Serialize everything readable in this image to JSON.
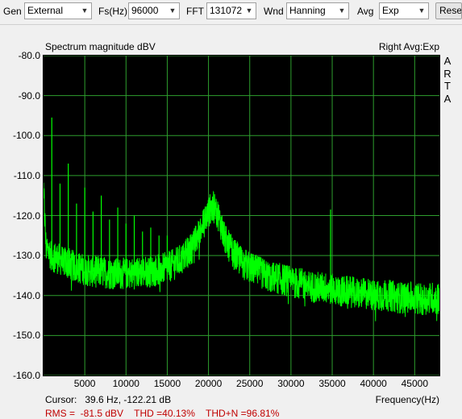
{
  "toolbar": {
    "gen_label": "Gen",
    "gen_value": "External",
    "fs_label": "Fs(Hz)",
    "fs_value": "96000",
    "fft_label": "FFT",
    "fft_value": "131072",
    "wnd_label": "Wnd",
    "wnd_value": "Hanning",
    "avg_label": "Avg",
    "avg_value": "Exp",
    "reset_label": "Reset"
  },
  "plot": {
    "title": "Spectrum magnitude dBV",
    "mode": "Right Avg:Exp",
    "watermark": [
      "A",
      "R",
      "T",
      "A"
    ],
    "cursor_readout": "Cursor:   39.6 Hz, -122.21 dB",
    "stats": "RMS =  -81.5 dBV    THD =40.13%    THD+N =96.81%"
  },
  "chart_data": {
    "type": "line",
    "title": "Spectrum magnitude dBV",
    "xlabel": "Frequency(Hz)",
    "ylabel": "",
    "xlim": [
      0,
      48000
    ],
    "ylim": [
      -160,
      -80
    ],
    "xticks": [
      5000,
      10000,
      15000,
      20000,
      25000,
      30000,
      35000,
      40000,
      45000
    ],
    "xtick_labels": [
      "5000",
      "10000",
      "15000",
      "20000",
      "25000",
      "30000",
      "35000",
      "40000",
      "45000"
    ],
    "yticks": [
      -80,
      -90,
      -100,
      -110,
      -120,
      -130,
      -140,
      -150,
      -160
    ],
    "ytick_labels": [
      "-80.0",
      "-90.0",
      "-100.0",
      "-110.0",
      "-120.0",
      "-130.0",
      "-140.0",
      "-150.0",
      "-160.0"
    ],
    "grid": true,
    "series": [
      {
        "color": "#00ff00",
        "x": [
          0,
          300,
          1000,
          2000,
          3000,
          4000,
          5000,
          6000,
          7000,
          8000,
          9000,
          10000,
          11000,
          12000,
          13000,
          14000,
          15000,
          16000,
          17000,
          18000,
          19000,
          19800,
          20300,
          20700,
          21200,
          22000,
          23000,
          24000,
          25000,
          26000,
          27000,
          28000,
          29000,
          30000,
          31000,
          32000,
          33000,
          34000,
          35000,
          36000,
          37000,
          38000,
          39000,
          40000,
          41000,
          42000,
          43000,
          44000,
          45000,
          46000,
          47000,
          48000
        ],
        "y": [
          -113,
          -128,
          -130,
          -131,
          -132,
          -133,
          -133.5,
          -134,
          -134,
          -134.5,
          -134.5,
          -134.5,
          -134.5,
          -134,
          -134,
          -133.5,
          -133,
          -132,
          -130.5,
          -128,
          -124,
          -120,
          -118,
          -118,
          -120,
          -126,
          -129.5,
          -131.5,
          -133,
          -134,
          -135,
          -135.5,
          -136,
          -136.5,
          -137,
          -137.5,
          -138,
          -138,
          -138.5,
          -139,
          -139,
          -139.5,
          -139.5,
          -140,
          -140,
          -140,
          -140.5,
          -140.5,
          -140.5,
          -141,
          -140.5,
          -141
        ],
        "noise_db": 4
      }
    ],
    "spikes": [
      {
        "x": 1000,
        "y": -95.5
      },
      {
        "x": 2000,
        "y": -112
      },
      {
        "x": 3000,
        "y": -107
      },
      {
        "x": 4000,
        "y": -117
      },
      {
        "x": 5000,
        "y": -113
      },
      {
        "x": 6000,
        "y": -119
      },
      {
        "x": 7000,
        "y": -115
      },
      {
        "x": 8000,
        "y": -121
      },
      {
        "x": 9000,
        "y": -118
      },
      {
        "x": 10000,
        "y": -122
      },
      {
        "x": 11000,
        "y": -120
      },
      {
        "x": 12000,
        "y": -124
      },
      {
        "x": 13000,
        "y": -123
      },
      {
        "x": 14000,
        "y": -125
      },
      {
        "x": 15000,
        "y": -125
      },
      {
        "x": 34800,
        "y": -118.5
      }
    ]
  }
}
